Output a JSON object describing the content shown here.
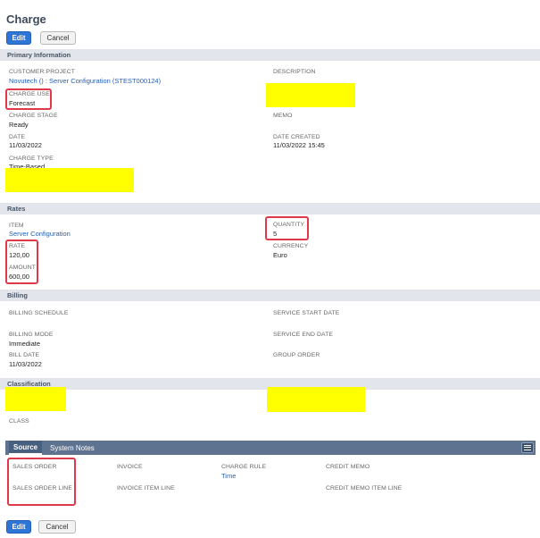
{
  "page": {
    "title": "Charge"
  },
  "toolbar": {
    "edit_label": "Edit",
    "cancel_label": "Cancel"
  },
  "sections": {
    "primary": "Primary Information",
    "rates": "Rates",
    "billing": "Billing",
    "classification": "Classification"
  },
  "primary": {
    "customer_project_label": "CUSTOMER:PROJECT",
    "customer_project_value": "Novutech () : Server Configuration (STEST000124)",
    "description_label": "DESCRIPTION",
    "charge_use_label": "CHARGE USE",
    "charge_use_value": "Forecast",
    "memo_label": "MEMO",
    "charge_stage_label": "CHARGE STAGE",
    "charge_stage_value": "Ready",
    "date_label": "DATE",
    "date_value": "11/03/2022",
    "date_created_label": "DATE CREATED",
    "date_created_value": "11/03/2022 15:45",
    "charge_type_label": "CHARGE TYPE",
    "charge_type_value": "Time-Based"
  },
  "rates": {
    "item_label": "ITEM",
    "item_value": "Server Configuration",
    "quantity_label": "QUANTITY",
    "quantity_value": "5",
    "rate_label": "RATE",
    "rate_value": "120,00",
    "currency_label": "CURRENCY",
    "currency_value": "Euro",
    "amount_label": "AMOUNT",
    "amount_value": "600,00"
  },
  "billing": {
    "schedule_label": "BILLING SCHEDULE",
    "service_start_label": "SERVICE START DATE",
    "mode_label": "BILLING MODE",
    "mode_value": "Immediate",
    "service_end_label": "SERVICE END DATE",
    "bill_date_label": "BILL DATE",
    "bill_date_value": "11/03/2022",
    "group_order_label": "GROUP ORDER"
  },
  "classification": {
    "class_label": "CLASS"
  },
  "tabs": {
    "source": "Source",
    "system_notes": "System Notes"
  },
  "source": {
    "sales_order_label": "SALES ORDER",
    "invoice_label": "INVOICE",
    "charge_rule_label": "CHARGE RULE",
    "charge_rule_value": "Time",
    "credit_memo_label": "CREDIT MEMO",
    "sales_order_line_label": "SALES ORDER LINE",
    "invoice_item_line_label": "INVOICE ITEM LINE",
    "credit_memo_item_line_label": "CREDIT MEMO ITEM LINE"
  },
  "colors": {
    "primary_button": "#2f75d6",
    "highlight": "#ffff00",
    "annotation_box": "#e0394a",
    "tab_bar": "#5d7390",
    "link": "#2760b5"
  }
}
